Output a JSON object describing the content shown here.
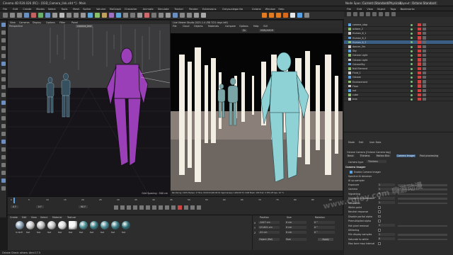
{
  "title_bar": {
    "title": "Cinema 4D R20.026 (RC) - [03D_Camera_link.c4d *] - Main",
    "node_space_label": "Node Space:",
    "node_space_value": "Current (Standard/Physical)",
    "layout_label": "Layout:",
    "layout_value": "Octane Standard"
  },
  "menu_bar": {
    "items": [
      "File",
      "Edit",
      "Create",
      "Modes",
      "Select",
      "Tools",
      "Mesh",
      "Spline",
      "Volume",
      "MoGraph",
      "Character",
      "Animate",
      "Simulate",
      "Tracker",
      "Render",
      "Extensions",
      "Greyscalegorilla",
      "Octane",
      "Window",
      "Help"
    ],
    "right_items": [
      "File",
      "Edit",
      "View",
      "Object",
      "Tags",
      "Bookmarks"
    ]
  },
  "viewport_left": {
    "menu": [
      "View",
      "Cameras",
      "Display",
      "Options",
      "Filter",
      "Panel"
    ],
    "camera_name": "Perspective",
    "tag": "camera_test",
    "grid_spacing": "Grid Spacing : 500 cm"
  },
  "octane_viewer": {
    "title": "Live Viewer Studio 2021.1.4 (R8 7/21 days left)",
    "menu": [
      "File",
      "Cloud",
      "Objects",
      "Materials",
      "Compare",
      "Options",
      "Help",
      "GUI"
    ],
    "mode": "DL",
    "render_preset": "HDR/AHDR",
    "status": "Rendering: 100%  Ms/sec: 0  Time: 00:00:01/00:00:01  Spp/maxspp: 128/128  Tri: 0/48  Mesh: 183  Hair: 0  RTX:off  Gpu: 43 °C"
  },
  "object_manager": {
    "objects": [
      "camera_stop",
      "octane_2",
      "Human_6_1",
      "Human_6_2",
      "Human_6_3",
      "dancer_3m",
      "Sky",
      "Octane Light",
      "Octane Light",
      "OctaneSky",
      "Null Element",
      "Fluid_1",
      "Octane",
      "Environment",
      "Floor",
      "ext",
      "cube",
      "tree"
    ]
  },
  "attributes": {
    "tabs": [
      "Mode",
      "Edit",
      "User Data"
    ],
    "object_name": "Octane Camera [Octane Camera tag]",
    "sub_tabs": [
      "Basic",
      "Thinlens",
      "Motion Blur",
      "Camera Imager",
      "Post processing"
    ],
    "camera_type_label": "Camera type",
    "camera_type_value": "Thinlens",
    "section": "Camera Imager",
    "enable_label": "Enable Camera Imager",
    "spectral_label": "Spectral AI denoiser",
    "ai_upsampler_label": "AI up-sampler",
    "rows": [
      {
        "label": "Exposure",
        "value": "1"
      },
      {
        "label": "Gamma",
        "value": "1"
      },
      {
        "label": "Vignetting",
        "value": "0"
      },
      {
        "label": "Highlight compression",
        "value": "0"
      },
      {
        "label": "Saturation",
        "value": "1"
      },
      {
        "label": "White point",
        "value": ""
      },
      {
        "label": "Neutral response",
        "value": ""
      },
      {
        "label": "Disable partial alpha",
        "value": ""
      },
      {
        "label": "Premultiplied alpha",
        "value": ""
      },
      {
        "label": "Hot pixel removal",
        "value": "1"
      },
      {
        "label": "Dithering",
        "value": ""
      },
      {
        "label": "Min display samples",
        "value": "1"
      },
      {
        "label": "Saturate to white",
        "value": "0"
      },
      {
        "label": "Max tone map interval",
        "value": ""
      }
    ]
  },
  "timeline": {
    "start": "0 F",
    "end": "90 F",
    "current": "0 F",
    "ticks": [
      "0",
      "5",
      "10",
      "15",
      "20",
      "25",
      "30",
      "35",
      "40",
      "45",
      "50",
      "55",
      "60",
      "65",
      "70",
      "75",
      "80",
      "85",
      "90"
    ]
  },
  "material_manager": {
    "menu": [
      "Create",
      "Edit",
      "View",
      "Select",
      "Material",
      "Texture"
    ],
    "materials": [
      "OctDiff",
      "Mat",
      "Mat",
      "Mat",
      "Mat",
      "Mat",
      "Mat",
      "Mat",
      "Mat",
      "Mat",
      "Mat"
    ]
  },
  "coordinates": {
    "headers": [
      "Position",
      "Size",
      "Rotation"
    ],
    "x": {
      "pos": "-1447 cm",
      "size": "0 cm",
      "rot": "0 °"
    },
    "y": {
      "pos": "121401 cm",
      "size": "0 cm",
      "rot": "0 °"
    },
    "z": {
      "pos": "-41 cm",
      "size": "0 cm",
      "rot": "0 °"
    },
    "mode": "Object (Rel)",
    "size_mode": "Size",
    "apply": "Apply"
  },
  "status_bar": {
    "text": "Octane Check: others: Ahrd 17.5"
  },
  "watermark": {
    "text": "www.cgjoy.com 嗨游动漫"
  },
  "colors": {
    "accent": "#5aa2e6",
    "octane_orange": "#e07b22"
  }
}
